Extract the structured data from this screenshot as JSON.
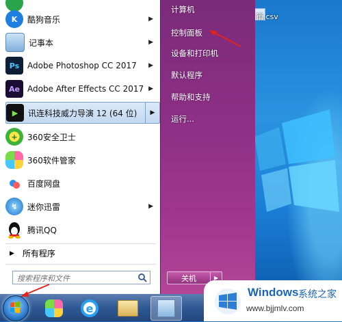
{
  "desktop": {
    "file_label": "销.csv"
  },
  "start_menu": {
    "programs": [
      {
        "label": "酷狗音乐",
        "icon": "kugou-music-icon",
        "has_submenu": true
      },
      {
        "label": "记事本",
        "icon": "notepad-icon",
        "has_submenu": true
      },
      {
        "label": "Adobe Photoshop CC 2017",
        "icon": "photoshop-icon",
        "has_submenu": true
      },
      {
        "label": "Adobe After Effects CC 2017",
        "icon": "after-effects-icon",
        "has_submenu": true
      },
      {
        "label": "讯连科技威力导演 12 (64 位)",
        "icon": "powerdirector-icon",
        "has_submenu": true,
        "highlighted": true
      },
      {
        "label": "360安全卫士",
        "icon": "360-safe-icon",
        "has_submenu": false
      },
      {
        "label": "360软件管家",
        "icon": "360-software-icon",
        "has_submenu": false
      },
      {
        "label": "百度网盘",
        "icon": "baidu-netdisk-icon",
        "has_submenu": false
      },
      {
        "label": "迷你迅雷",
        "icon": "mini-thunder-icon",
        "has_submenu": true
      },
      {
        "label": "腾讯QQ",
        "icon": "qq-penguin-icon",
        "has_submenu": false
      }
    ],
    "icon_text": {
      "photoshop": "Ps",
      "after_effects": "Ae"
    },
    "all_programs": "所有程序",
    "search_placeholder": "搜索程序和文件",
    "right_items": [
      {
        "label": "计算机"
      },
      {
        "label": "控制面板"
      },
      {
        "label": "设备和打印机"
      },
      {
        "label": "默认程序"
      },
      {
        "label": "帮助和支持"
      },
      {
        "label": "运行..."
      }
    ],
    "shutdown_label": "关机"
  },
  "watermark": {
    "brand": "Windows",
    "brand_cn": "系统之家",
    "url": "www.bjjmlv.com"
  },
  "colors": {
    "accent_red": "#e3241b",
    "start_menu_right": "#8c2f86",
    "desktop_blue": "#1f86d8"
  }
}
